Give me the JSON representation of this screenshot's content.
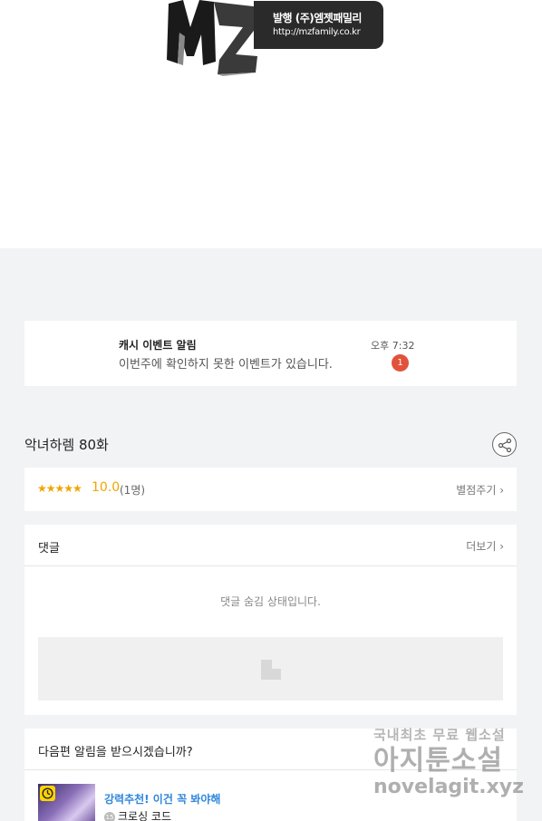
{
  "publisher": {
    "brand": "MZ",
    "name": "발행 (주)엠젯패밀리",
    "url": "http://mzfamily.co.kr"
  },
  "notice": {
    "title": "캐시 이벤트 알림",
    "message": "이번주에 확인하지 못한 이벤트가 있습니다.",
    "time": "오후 7:32",
    "badge_count": "1"
  },
  "episode": {
    "title": "악녀하렘 80화"
  },
  "rating": {
    "stars": "★★★★★",
    "score": "10.0",
    "count": "(1명)",
    "rate_link": "별점주기 ›"
  },
  "comments": {
    "label": "댓글",
    "more_link": "더보기 ›",
    "hidden_message": "댓글 숨김 상태입니다."
  },
  "next_episode": {
    "question": "다음편 알림을 받으시겠습니까?",
    "promo": "강력추천! 이건 꼭 봐야해",
    "age_rating": "15",
    "series_name": "크로싱 코드"
  },
  "watermark": {
    "line1": "국내최초 무료 웹소설",
    "line2": "아지툰소설",
    "line3": "novelagit.xyz"
  },
  "colors": {
    "accent_star": "#f0a500",
    "badge": "#e2523b",
    "promo_link": "#2e86de",
    "background": "#f2f3f5"
  }
}
